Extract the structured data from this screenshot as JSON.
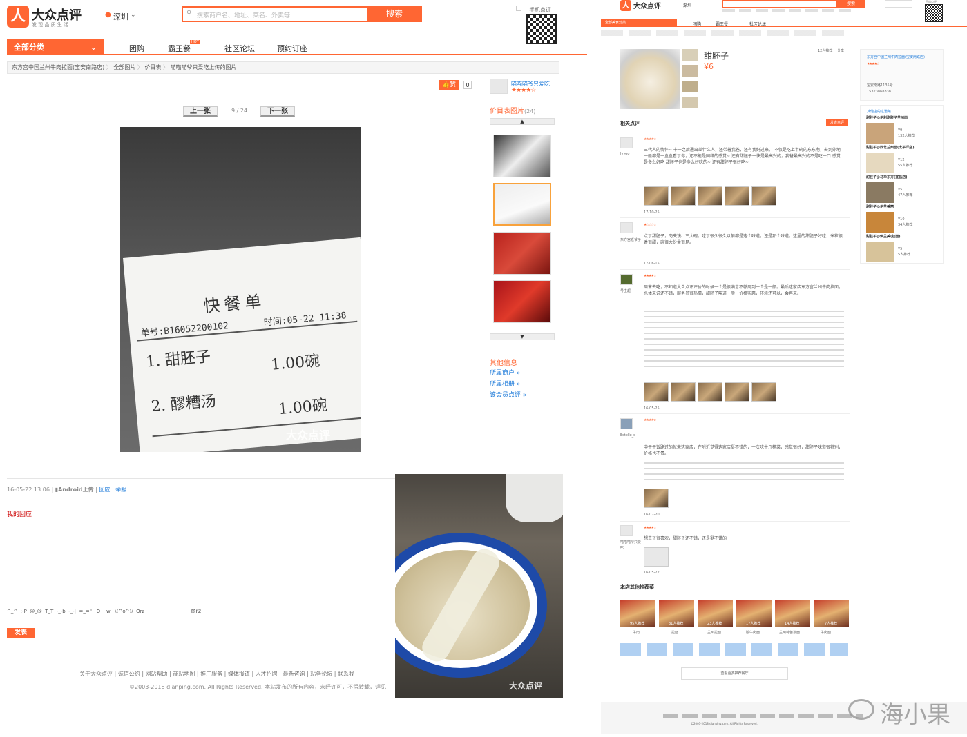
{
  "left": {
    "logo_text": "大众点评",
    "slogan": "发 现 品 质 生 活",
    "city": "深圳",
    "search_placeholder": "搜索商户名、地址、菜名、外卖等",
    "search_btn": "搜索",
    "qr_label": "手机点评",
    "nav_all": "全部分类",
    "nav": [
      "团购",
      "霸王餐",
      "社区论坛",
      "预约订座"
    ],
    "nav_hot": "HOT",
    "breadcrumb": [
      "东方宫中国兰州牛肉拉面(宝安南路店)",
      "全部图片",
      "价目表",
      "喵喵喵爷只爱吃上传的图片"
    ],
    "like_label": "赞",
    "like_count": "0",
    "uploader": "喵喵喵爷只爱吃",
    "prev_btn": "上一张",
    "page_indicator": "9 / 24",
    "next_btn": "下一张",
    "receipt": {
      "title": "快餐单",
      "order_no": "单号:B16052200102",
      "time": "时间:05-22 11:38",
      "items": [
        {
          "n": "1.",
          "name": "甜胚子",
          "qty": "1.00碗"
        },
        {
          "n": "2.",
          "name": "醪糟汤",
          "qty": "1.00碗"
        }
      ],
      "watermark": "大众点评"
    },
    "album_title": "价目表图片",
    "album_count": "(24)",
    "other_title": "其他信息",
    "other_links": [
      "所属商户 »",
      "所属相册 »",
      "该会员点评 »"
    ],
    "meta_date": "16-05-22 13:06",
    "meta_device": "Android上传",
    "meta_reply": "回应",
    "meta_report": "举报",
    "my_reply": "我的回应",
    "emoticons": "^_^  :-P  @_@  T_T  -_-b  -_-|  =_=\"  ·O·  ·w·  \\(^o^)/  Orz",
    "submit_btn": "发表",
    "footer_links": [
      "关于大众点评",
      "诚信公约",
      "网站帮助",
      "商站地图",
      "推广服务",
      "媒体报道",
      "人才招聘",
      "最新咨询",
      "站务论坛",
      "联系我"
    ],
    "copyright": "©2003-2018 dianping.com, All Rights Reserved.  本站发布的所有内容，未经许可，不得转载，详见"
  },
  "overlay_watermark": "大众点评",
  "right": {
    "logo_text": "大众点评",
    "city": "深圳",
    "search_btn": "搜索",
    "qr_label": "手机点评",
    "nav_all": "全部美食分类",
    "nav": [
      "团购",
      "霸王餐",
      "社区论坛"
    ],
    "dish_name": "甜胚子",
    "price": "¥6",
    "recommend_count": "12人推荐",
    "share": "分享",
    "related_reviews": "相关点评",
    "write_review": "发表点评",
    "reviews": [
      {
        "user": "lvyoo",
        "date": "17-10-25",
        "text": "三代人的情怀~ 十一之后通出差什么人，还带着我爸，还有我妈过来。 不仅是吃上半碗的东东啊，去到外地一般都是一盒盒看了你，还不能是同样的感觉~ 还有甜胚子一快是最高兴的，我爸最高兴的不是吃一口 感觉是多么好吃 甜胚子也是多么好吃的~ 还有甜胚子很好吃~",
        "thumbs": 6
      },
      {
        "user": "东方宫老爷子",
        "date": "17-06-15",
        "text": "点了甜胚子，肉夹馍、三大碗。吃了很久很久以前都是这个味道，还是那个味道。这里的甜胚子好吃，米粒很香很甜，碗很大份量很足。",
        "thumbs": 0
      },
      {
        "user": "号主超",
        "date": "16-05-25",
        "text": "周末去吃，不知道大众点评评价的时候一个是很满意不够周到一个是一般。最后这家店东方宫兰州牛肉拉面，总体来说还不错，服务员很热情，甜胚子味道一般，价格实惠，环境还可以，会再来。",
        "thumbs": 5
      },
      {
        "user": "Estelle_s",
        "date": "16-07-20",
        "text": "中午午饭路过的就来这家店，在附近觉得这家店挺不错的，一次吃十几样菜，感觉很好，甜胚子味道很特别，价格也不贵。",
        "thumbs": 1
      },
      {
        "user": "喵喵喵爷只爱吃",
        "date": "16-05-22",
        "text": "想去了很喜欢，甜胚子还不错，还是挺不错的",
        "thumbs": 1
      }
    ],
    "other_recs_title": "本店其他推荐菜",
    "other_recs": [
      {
        "name": "牛肉",
        "count": "95人推荐"
      },
      {
        "name": "拉面",
        "count": "31人推荐"
      },
      {
        "name": "兰州拉面",
        "count": "23人推荐"
      },
      {
        "name": "酸牛肉面",
        "count": "17人推荐"
      },
      {
        "name": "兰州特色凉面",
        "count": "14人推荐"
      },
      {
        "name": "牛肉面",
        "count": "7人推荐"
      }
    ],
    "more_btn": "查看更多推荐餐厅",
    "shop_name": "东方宫中国兰州牛肉拉面(宝安南路店)",
    "shop_addr": "宝安南路1135号",
    "shop_tel": "15323868838",
    "same_title": "其他店的这道菜",
    "same_list": [
      {
        "name": "甜胚子@伊利甜胚子兰州面",
        "price": "¥9",
        "count": "132人推荐"
      },
      {
        "name": "甜胚子@西北兰州面(太平洋店)",
        "price": "¥12",
        "count": "55人推荐"
      },
      {
        "name": "甜胚子@马华东方(宜昌店)",
        "price": "¥5",
        "count": "47人推荐"
      },
      {
        "name": "甜胚子@伊兰美丽",
        "price": "¥10",
        "count": "34人推荐"
      },
      {
        "name": "甜胚子@伊兰美(拉面)",
        "price": "¥5",
        "count": "5人推荐"
      }
    ],
    "footer_copy": "©2003-2018 dianping.com, All Rights Reserved."
  },
  "weibo_mark": "海小果",
  "colors": {
    "accent": "#ff6633",
    "link": "#1d7ad9"
  }
}
